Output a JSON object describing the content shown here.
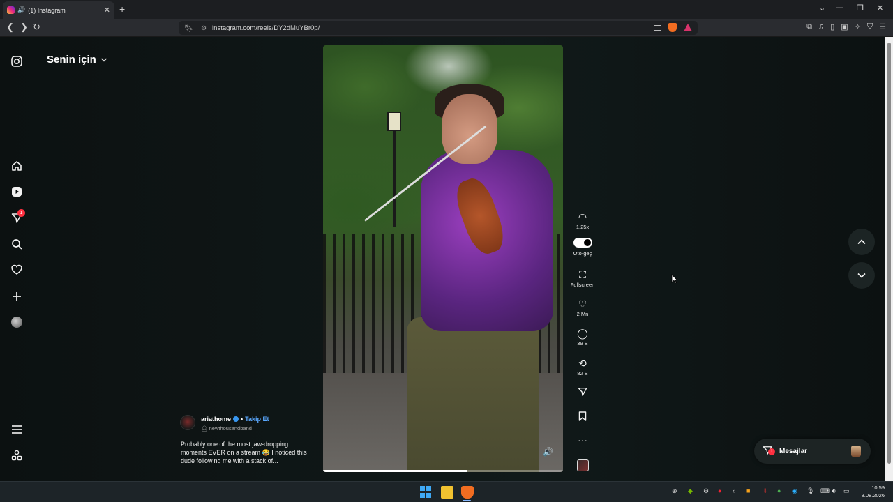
{
  "browser": {
    "tab_title": "(1) Instagram",
    "tab_close": "✕",
    "new_tab": "+",
    "window_controls": [
      "⌄",
      "—",
      "❐",
      "✕"
    ],
    "url": "instagram.com/reels/DY2dMuYBr0p/"
  },
  "instagram": {
    "feed_title": "Senin için",
    "left_nav": {
      "notification_count": "1"
    },
    "video": {
      "progress_fraction": 0.6
    },
    "actions": {
      "speed": "1.25x",
      "autoplay_label": "Oto-geç",
      "fullscreen_label": "Fullscreen",
      "likes": "2 Mn",
      "comments": "39 B",
      "reposts": "82 B",
      "more": "···"
    },
    "post": {
      "username": "ariathome",
      "separator": "•",
      "follow_label": "Takip Et",
      "audio": "newthousandband",
      "caption": "Probably one of the most jaw-dropping moments EVER on a stream 😂 I noticed this dude following me with a stack of..."
    },
    "messages": {
      "label": "Mesajlar",
      "count": "1"
    }
  },
  "taskbar": {
    "time": "10:59",
    "date": "8.08.2026"
  },
  "colors": {
    "page_bg": "#0c1111",
    "link_blue": "#5aa8ff",
    "badge_red": "#ff3040",
    "brave_orange": "#f26d21"
  }
}
